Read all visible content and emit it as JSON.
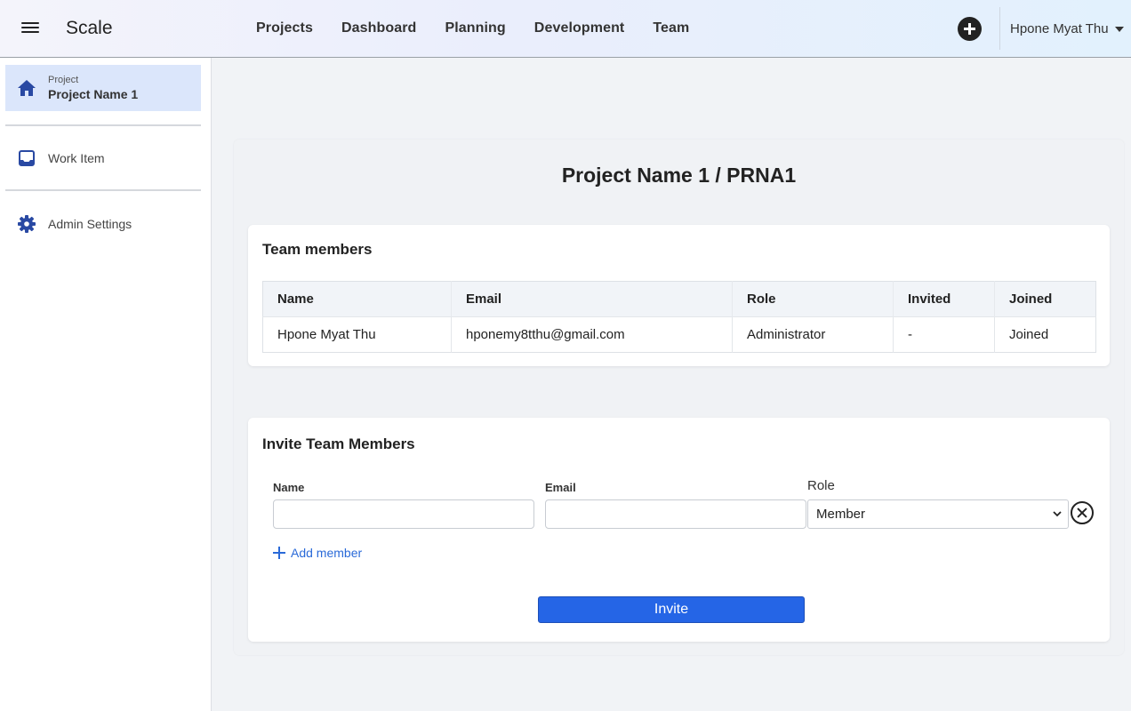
{
  "app": {
    "title": "Scale"
  },
  "nav": {
    "items": [
      "Projects",
      "Dashboard",
      "Planning",
      "Development",
      "Team"
    ]
  },
  "user": {
    "name": "Hpone Myat Thu"
  },
  "sidebar": {
    "project_caption": "Project",
    "project_name": "Project Name 1",
    "items": [
      {
        "label": "Work Item",
        "icon": "inbox-icon"
      },
      {
        "label": "Admin Settings",
        "icon": "gear-icon"
      }
    ]
  },
  "page": {
    "title": "Project Name 1 / PRNA1"
  },
  "team_members": {
    "title": "Team members",
    "columns": [
      "Name",
      "Email",
      "Role",
      "Invited",
      "Joined"
    ],
    "rows": [
      [
        "Hpone Myat Thu",
        "hponemy8tthu@gmail.com",
        "Administrator",
        "-",
        "Joined"
      ]
    ]
  },
  "invite": {
    "title": "Invite Team Members",
    "name_label": "Name",
    "email_label": "Email",
    "role_label": "Role",
    "name_value": "",
    "email_value": "",
    "role_value": "Member",
    "add_member_label": "Add member",
    "invite_button": "Invite"
  },
  "colors": {
    "accent": "#2565e6",
    "link": "#2a6ad8",
    "active_bg": "#dbe6fb",
    "icon_blue": "#2949a3"
  }
}
